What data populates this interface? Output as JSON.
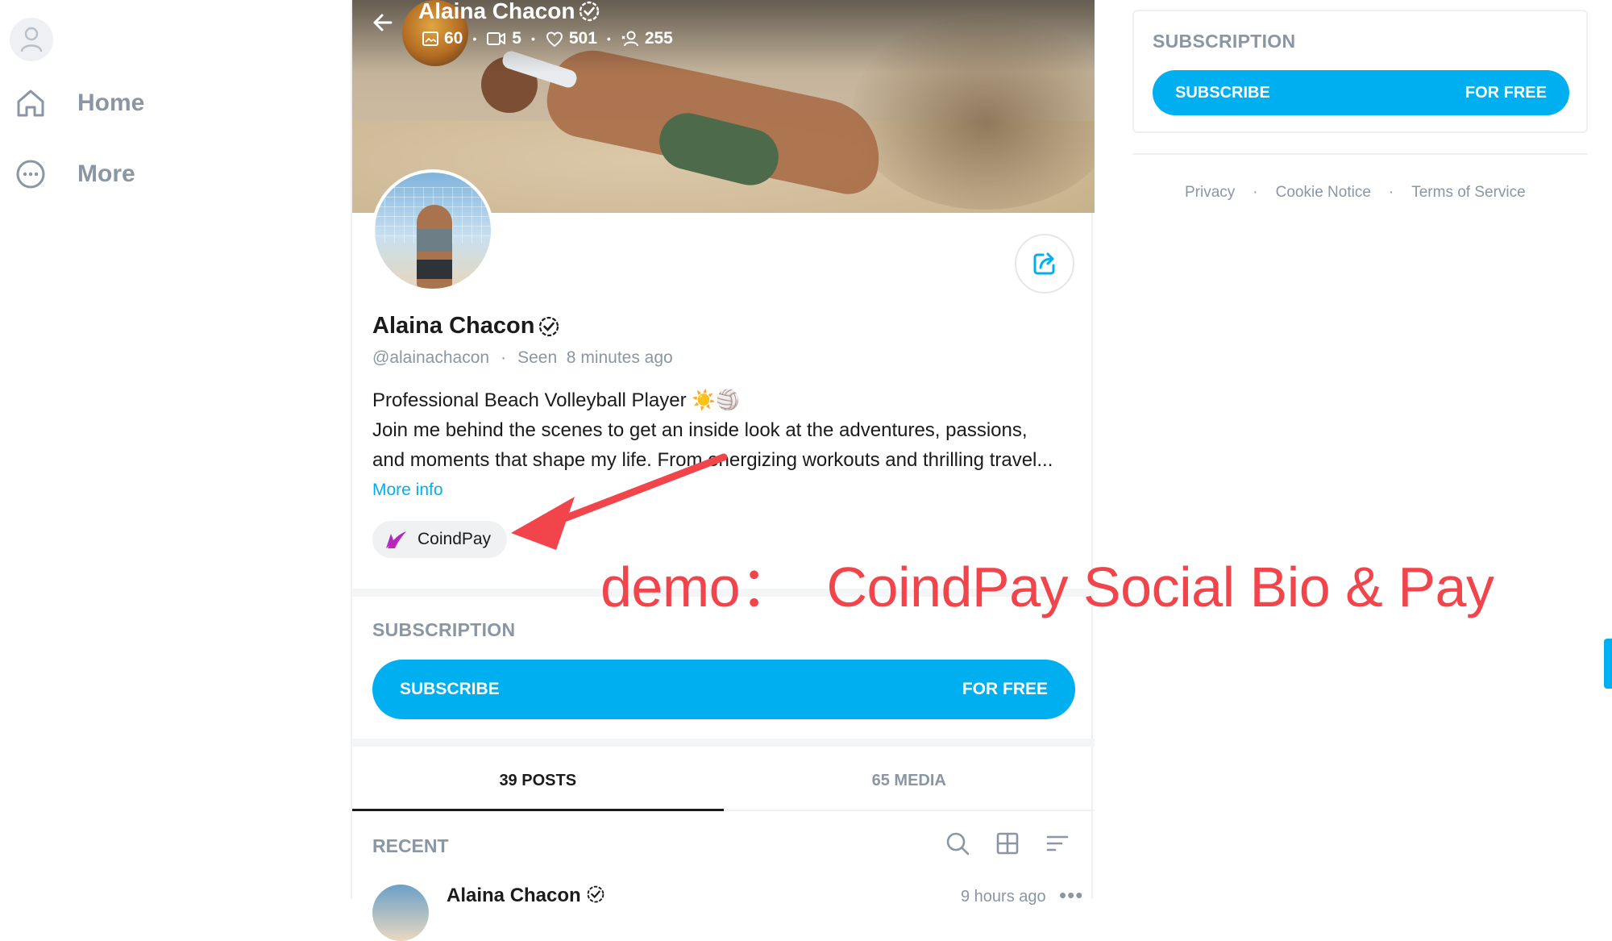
{
  "nav": {
    "items": [
      {
        "label": "Home",
        "icon": "home-icon"
      },
      {
        "label": "More",
        "icon": "more-circle-icon"
      }
    ]
  },
  "profile": {
    "name": "Alaina Chacon",
    "stats": {
      "photos": "60",
      "videos": "5",
      "likes": "501",
      "fans": "255"
    },
    "handle": "@alainachacon",
    "seen": "Seen  8 minutes ago",
    "bio_line1": "Professional Beach Volleyball Player ☀️🏐",
    "bio_line2": "Join me behind the scenes to get an inside look at the adventures, passions,",
    "bio_line3": "and moments that shape my life. From energizing workouts and thrilling travel...",
    "more_info": "More info",
    "link_chip": "CoindPay"
  },
  "subscription": {
    "title": "SUBSCRIPTION",
    "button_left": "SUBSCRIBE",
    "button_right": "FOR FREE"
  },
  "tabs": [
    {
      "label": "39 POSTS",
      "active": true
    },
    {
      "label": "65 MEDIA",
      "active": false
    }
  ],
  "feed": {
    "section": "RECENT",
    "post": {
      "author": "Alaina Chacon",
      "time": "9 hours ago",
      "menu": "•••"
    }
  },
  "right": {
    "subscription_title": "SUBSCRIPTION",
    "button_left": "SUBSCRIBE",
    "button_right": "FOR FREE",
    "footer": [
      "Privacy",
      "Cookie Notice",
      "Terms of Service"
    ],
    "footer_sep": "·"
  },
  "annotation": {
    "text": "demo：  CoindPay Social Bio & Pay"
  },
  "colors": {
    "accent": "#00aff0",
    "muted": "#8a96a3",
    "annotation": "#f2444b"
  }
}
